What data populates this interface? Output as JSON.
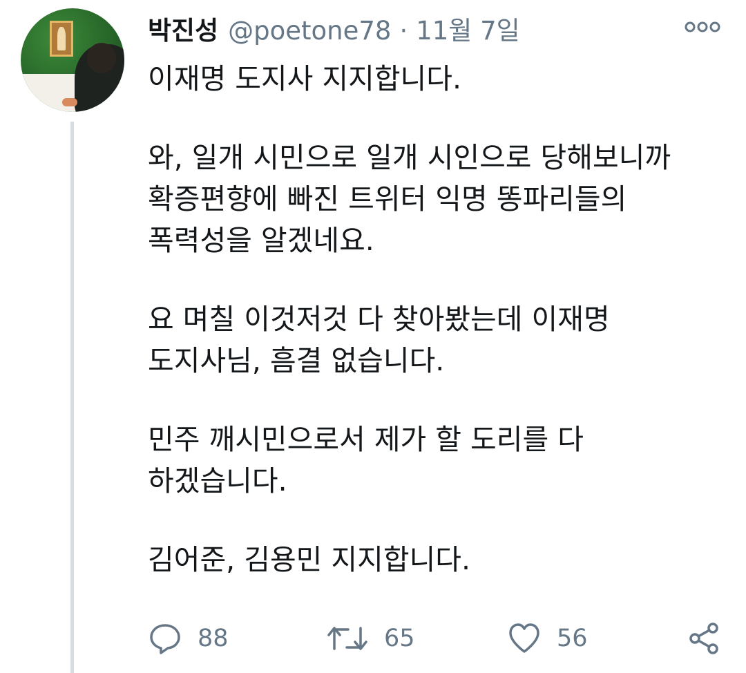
{
  "tweet": {
    "display_name": "박진성",
    "handle": "@poetone78",
    "separator": "·",
    "date": "11월 7일",
    "paragraphs": [
      "이재명 도지사 지지합니다.",
      "와, 일개 시민으로 일개 시인으로 당해보니까 확증편향에 빠진 트위터 익명 똥파리들의 폭력성을 알겠네요.",
      "요 며칠 이것저것 다 찾아봤는데 이재명 도지사님, 흠결 없습니다.",
      "민주 깨시민으로서 제가 할 도리를 다 하겠습니다.",
      "김어준, 김용민 지지합니다."
    ],
    "actions": {
      "reply_count": "88",
      "retweet_count": "65",
      "like_count": "56"
    }
  },
  "icons": {
    "more": "more-options-icon",
    "reply": "reply-icon",
    "retweet": "retweet-icon",
    "like": "heart-icon",
    "share": "share-icon"
  },
  "colors": {
    "text": "#14171a",
    "secondary": "#657786",
    "thread_line": "#d7dcdf"
  }
}
